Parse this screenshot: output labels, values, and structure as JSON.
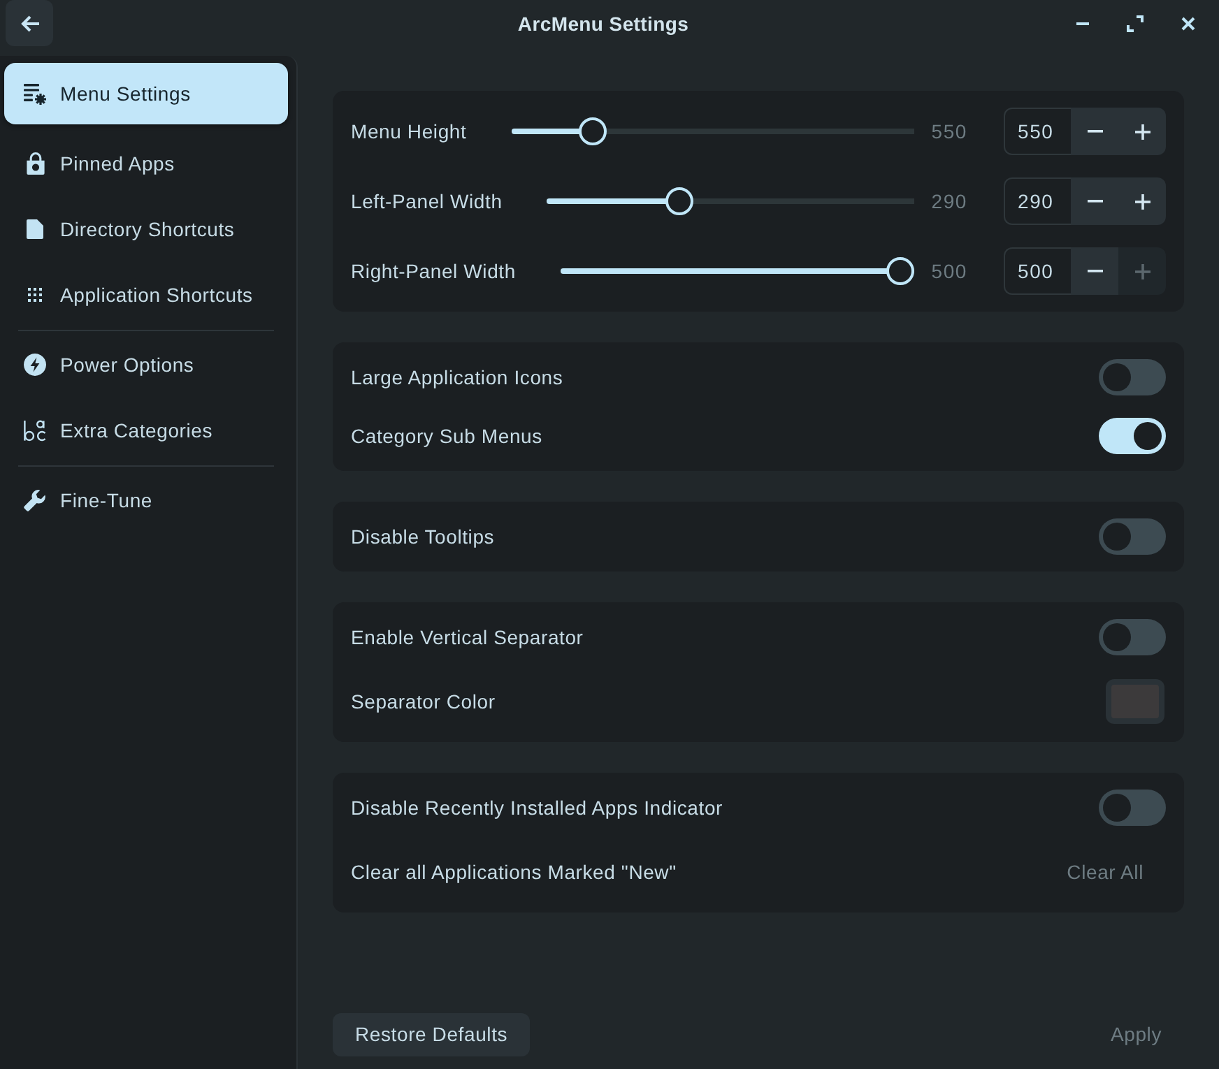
{
  "window": {
    "title": "ArcMenu Settings"
  },
  "sidebar": {
    "groups": [
      {
        "items": [
          {
            "label": "Menu Settings",
            "selected": true
          },
          {
            "label": "Pinned Apps",
            "selected": false
          },
          {
            "label": "Directory Shortcuts",
            "selected": false
          },
          {
            "label": "Application Shortcuts",
            "selected": false
          }
        ]
      },
      {
        "items": [
          {
            "label": "Power Options",
            "selected": false
          },
          {
            "label": "Extra Categories",
            "selected": false
          }
        ]
      },
      {
        "items": [
          {
            "label": "Fine-Tune",
            "selected": false
          }
        ]
      }
    ]
  },
  "cards": [
    {
      "rows": [
        {
          "kind": "slider",
          "label": "Menu Height",
          "level": 0.18,
          "reading": "550",
          "value": "550",
          "decrease_disabled": false,
          "increase_disabled": false
        },
        {
          "kind": "slider",
          "label": "Left-Panel Width",
          "level": 0.35,
          "reading": "290",
          "value": "290",
          "decrease_disabled": false,
          "increase_disabled": false
        },
        {
          "kind": "slider",
          "label": "Right-Panel Width",
          "level": 1,
          "reading": "500",
          "value": "500",
          "decrease_disabled": false,
          "increase_disabled": true
        }
      ]
    },
    {
      "rows": [
        {
          "kind": "switch",
          "label": "Large Application Icons",
          "on": false
        },
        {
          "kind": "switch",
          "label": "Category Sub Menus",
          "on": true
        }
      ]
    },
    {
      "rows": [
        {
          "kind": "switch",
          "label": "Disable Tooltips",
          "on": false
        }
      ]
    },
    {
      "rows": [
        {
          "kind": "switch",
          "label": "Enable Vertical Separator",
          "on": false
        },
        {
          "kind": "color",
          "label": "Separator Color",
          "color": "#3c3a3b"
        }
      ]
    },
    {
      "rows": [
        {
          "kind": "switch",
          "label": "Disable Recently Installed Apps Indicator",
          "on": false
        },
        {
          "kind": "button",
          "label": "Clear all Applications Marked \"New\"",
          "action": {
            "label": "Clear All",
            "disabled": true
          }
        }
      ]
    }
  ],
  "footer": {
    "restore_button": {
      "label": "Restore Defaults"
    },
    "apply_button": {
      "label": "Apply",
      "disabled": true
    }
  }
}
